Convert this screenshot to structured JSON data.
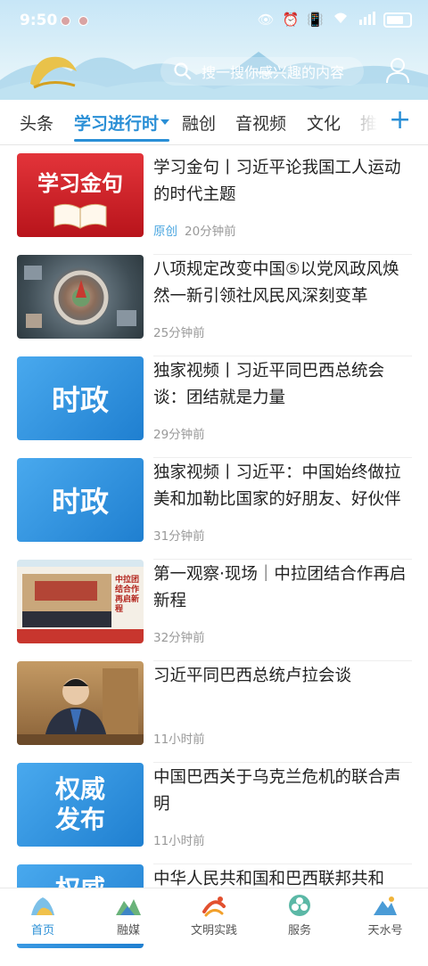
{
  "status_bar": {
    "time": "9:50"
  },
  "header": {
    "search_placeholder": "搜一搜你感兴趣的内容"
  },
  "tabs": [
    {
      "label": "头条"
    },
    {
      "label": "学习进行时"
    },
    {
      "label": "融创"
    },
    {
      "label": "音视频"
    },
    {
      "label": "文化"
    },
    {
      "label": "推"
    }
  ],
  "thumb_labels": {
    "item1": "学习金句",
    "item3": "时政",
    "item4": "时政",
    "item5": "中拉团结合作 再启新程",
    "item7": "权威发布",
    "item8": "权威"
  },
  "feed": [
    {
      "title": "学习金句丨习近平论我国工人运动的时代主题",
      "source": "原创",
      "time": "20分钟前"
    },
    {
      "title": "八项规定改变中国⑤以党风政风焕然一新引领社风民风深刻变革",
      "source": "",
      "time": "25分钟前"
    },
    {
      "title": "独家视频丨习近平同巴西总统会谈：团结就是力量",
      "source": "",
      "time": "29分钟前"
    },
    {
      "title": "独家视频丨习近平：中国始终做拉美和加勒比国家的好朋友、好伙伴",
      "source": "",
      "time": "31分钟前"
    },
    {
      "title": "第一观察·现场｜中拉团结合作再启新程",
      "source": "",
      "time": "32分钟前"
    },
    {
      "title": "习近平同巴西总统卢拉会谈",
      "source": "",
      "time": "11小时前"
    },
    {
      "title": "中国巴西关于乌克兰危机的联合声明",
      "source": "",
      "time": "11小时前"
    },
    {
      "title": "中华人民共和国和巴西联邦共和",
      "source": "",
      "time": ""
    }
  ],
  "bottom_nav": [
    {
      "label": "首页"
    },
    {
      "label": "融媒"
    },
    {
      "label": "文明实践"
    },
    {
      "label": "服务"
    },
    {
      "label": "天水号"
    }
  ],
  "colors": {
    "accent": "#2a8fd6",
    "muted": "#999999",
    "source": "#4aa6e0"
  }
}
